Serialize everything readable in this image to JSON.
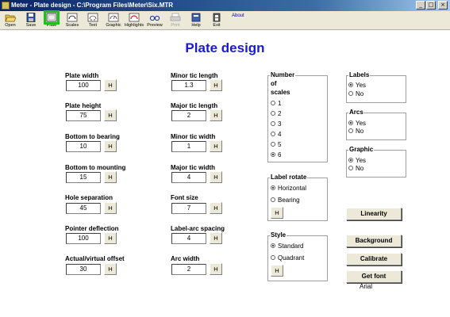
{
  "window": {
    "title": "Meter - Plate design - C:\\Program Files\\Meter\\Six.MTR",
    "min": "_",
    "max": "□",
    "close": "×"
  },
  "toolbar": {
    "items": [
      {
        "label": "Open",
        "icon": "folder-open-icon",
        "enabled": true
      },
      {
        "label": "Save",
        "icon": "save-disk-icon",
        "enabled": true
      },
      {
        "label": "Plate",
        "icon": "plate-icon",
        "enabled": true,
        "active": true
      },
      {
        "label": "Scales",
        "icon": "scales-icon",
        "enabled": true
      },
      {
        "label": "Text",
        "icon": "text-icon",
        "enabled": true
      },
      {
        "label": "Graphic",
        "icon": "graphic-icon",
        "enabled": true
      },
      {
        "label": "Highlights",
        "icon": "highlights-icon",
        "enabled": true
      },
      {
        "label": "Preview",
        "icon": "preview-glasses-icon",
        "enabled": true
      },
      {
        "label": "Print",
        "icon": "printer-icon",
        "enabled": false
      },
      {
        "label": "Help",
        "icon": "help-book-icon",
        "enabled": true
      },
      {
        "label": "Exit",
        "icon": "exit-door-icon",
        "enabled": true
      }
    ],
    "about": "About"
  },
  "page_title": "Plate design",
  "left_fields": [
    {
      "label": "Plate width",
      "value": "100",
      "h": "H"
    },
    {
      "label": "Plate height",
      "value": "75",
      "h": "H"
    },
    {
      "label": "Bottom to bearing",
      "value": "10",
      "h": "H"
    },
    {
      "label": "Bottom to mounting",
      "value": "15",
      "h": "H"
    },
    {
      "label": "Hole separation",
      "value": "45",
      "h": "H"
    },
    {
      "label": "Pointer deflection",
      "value": "100",
      "h": "H"
    },
    {
      "label": "Actual/virtual offset",
      "value": "30",
      "h": "H"
    }
  ],
  "mid_fields": [
    {
      "label": "Minor tic length",
      "value": "1.3",
      "h": "H"
    },
    {
      "label": "Major tic length",
      "value": "2",
      "h": "H"
    },
    {
      "label": "Minor tic width",
      "value": "1",
      "h": "H"
    },
    {
      "label": "Major tic width",
      "value": "4",
      "h": "H"
    },
    {
      "label": "Font size",
      "value": "7",
      "h": "H"
    },
    {
      "label": "Label-arc spacing",
      "value": "4",
      "h": "H"
    },
    {
      "label": "Arc width",
      "value": "2",
      "h": "H"
    }
  ],
  "scales": {
    "title_lines": [
      "Number",
      "of",
      "scales"
    ],
    "options": [
      "1",
      "2",
      "3",
      "4",
      "5",
      "6"
    ],
    "selected": "6"
  },
  "label_rotate": {
    "title": "Label rotate",
    "options": [
      "Horizontal",
      "Bearing"
    ],
    "selected": "Horizontal",
    "h": "H"
  },
  "style": {
    "title": "Style",
    "options": [
      "Standard",
      "Quadrant"
    ],
    "selected": "Standard",
    "h": "H"
  },
  "labels_group": {
    "title": "Labels",
    "options": [
      "Yes",
      "No"
    ],
    "selected": "Yes"
  },
  "arcs_group": {
    "title": "Arcs",
    "options": [
      "Yes",
      "No"
    ],
    "selected": "Yes"
  },
  "graphic_group": {
    "title": "Graphic",
    "options": [
      "Yes",
      "No"
    ],
    "selected": "Yes"
  },
  "buttons": {
    "linearity": "Linearity",
    "background": "Background",
    "calibrate": "Calibrate",
    "get_font": "Get font"
  },
  "font_name": "Arial"
}
